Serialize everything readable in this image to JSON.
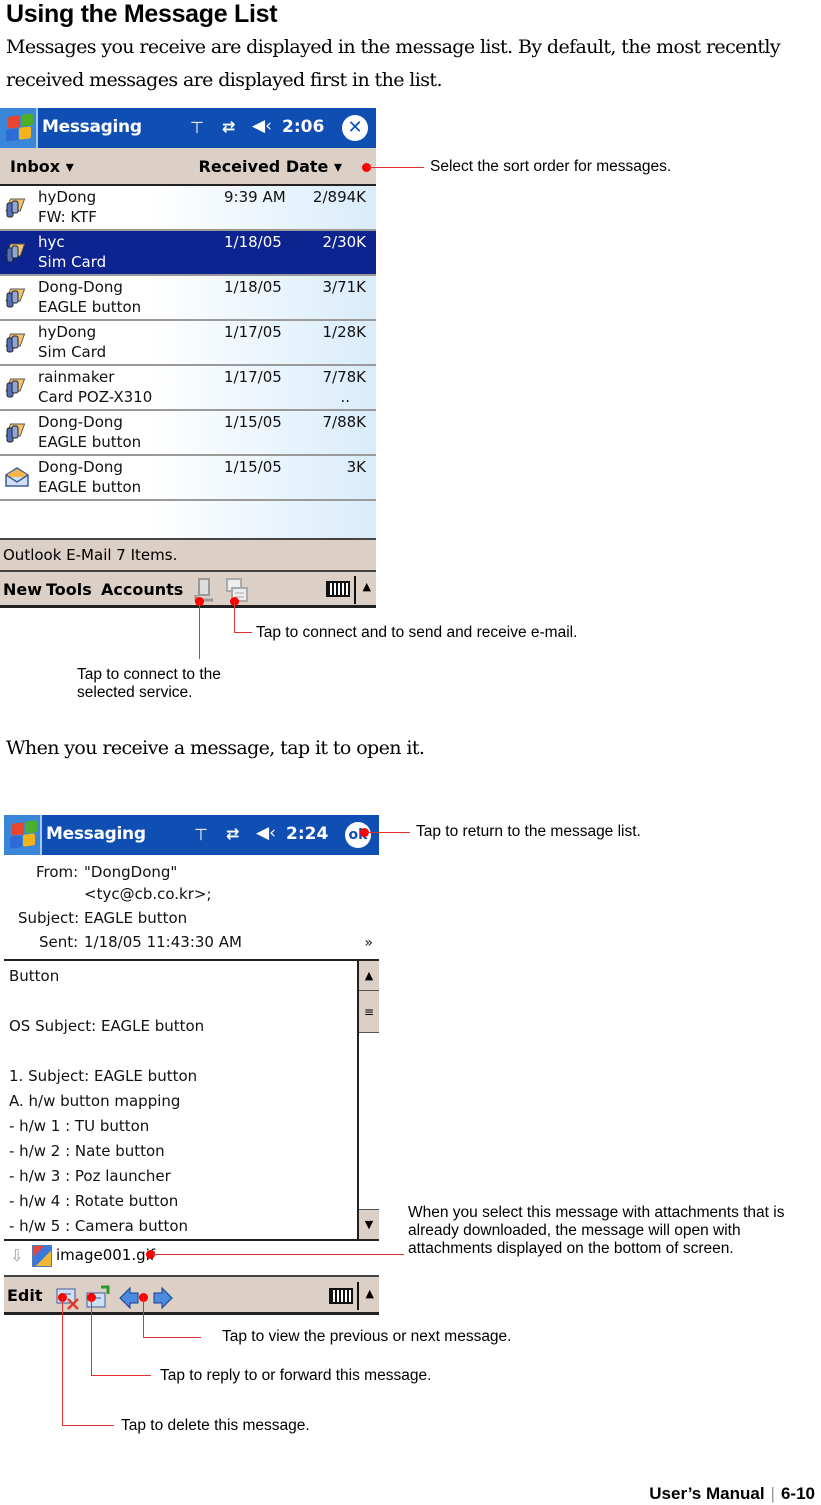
{
  "page": {
    "title": "Using the Message List",
    "intro": "Messages you receive are displayed in the message list. By default, the most recently received messages are displayed first in the list.",
    "intro2": "When you receive a message, tap it to open it.",
    "footer": {
      "manual": "User’s Manual",
      "page": "6-10"
    }
  },
  "screen1": {
    "titlebar": {
      "app": "Messaging",
      "time": "2:06",
      "signal_icon": "antenna-icon",
      "connectivity_icon": "sync-arrows-icon",
      "volume_icon": "speaker-icon",
      "close_label": "✕"
    },
    "header": {
      "folder": "Inbox",
      "sort": "Received Date"
    },
    "messages": [
      {
        "from": "hyDong",
        "subject": "FW: KTF",
        "date": "9:39 AM",
        "size": "2/894K",
        "icon": "attachment-mail-icon",
        "selected": false,
        "more": ""
      },
      {
        "from": "hyc",
        "subject": "Sim Card",
        "date": "1/18/05",
        "size": "2/30K",
        "icon": "attachment-mail-icon",
        "selected": true,
        "more": ""
      },
      {
        "from": "Dong-Dong",
        "subject": "EAGLE button",
        "date": "1/18/05",
        "size": "3/71K",
        "icon": "attachment-mail-icon",
        "selected": false,
        "more": ""
      },
      {
        "from": "hyDong",
        "subject": "Sim Card",
        "date": "1/17/05",
        "size": "1/28K",
        "icon": "attachment-mail-icon",
        "selected": false,
        "more": ""
      },
      {
        "from": "rainmaker",
        "subject": "Card POZ-X310",
        "date": "1/17/05",
        "size": "7/78K",
        "icon": "attachment-mail-icon",
        "selected": false,
        "more": ".."
      },
      {
        "from": "Dong-Dong",
        "subject": "EAGLE button",
        "date": "1/15/05",
        "size": "7/88K",
        "icon": "attachment-mail-icon",
        "selected": false,
        "more": ""
      },
      {
        "from": "Dong-Dong",
        "subject": "EAGLE button",
        "date": "1/15/05",
        "size": "3K",
        "icon": "open-envelope-icon",
        "selected": false,
        "more": ""
      }
    ],
    "status": "Outlook E-Mail  7 Items.",
    "menu": {
      "new": "New",
      "tools": "Tools",
      "accounts": "Accounts"
    }
  },
  "screen2": {
    "titlebar": {
      "app": "Messaging",
      "time": "2:24",
      "ok_label": "ok"
    },
    "header": {
      "from_label": "From:",
      "from_value": "\"DongDong\"",
      "from_email": "<tyc@cb.co.kr>;",
      "subject_label": "Subject:",
      "subject_value": "EAGLE button",
      "sent_label": "Sent:",
      "sent_value": "1/18/05 11:43:30 AM"
    },
    "body_lines": [
      "Button",
      "",
      "OS  Subject: EAGLE button",
      "",
      "1. Subject: EAGLE button",
      "A. h/w button mapping",
      "- h/w 1 : TU button",
      "- h/w 2 : Nate button",
      "- h/w 3 : Poz launcher",
      "- h/w 4 : Rotate button",
      "- h/w 5 : Camera button"
    ],
    "attachment": "image001.gif",
    "menu": {
      "edit": "Edit"
    }
  },
  "callouts": {
    "sort": "Select the sort order for messages.",
    "send_receive": "Tap to connect and to send and receive e-mail.",
    "connect": "Tap to connect to the selected service.",
    "return": "Tap to return to the message list.",
    "attachments": "When you select this message with attachments that is already downloaded, the message will open with attachments displayed on the bottom of screen.",
    "prev_next": "Tap to view the previous or next message.",
    "reply": "Tap to reply to or forward this message.",
    "delete": "Tap to delete this message."
  }
}
